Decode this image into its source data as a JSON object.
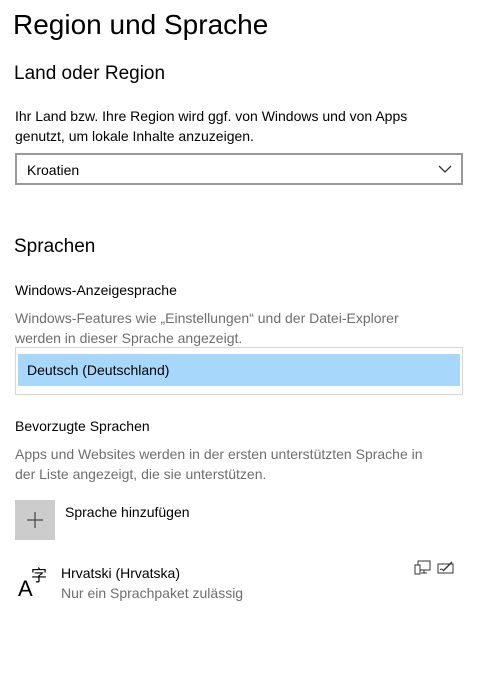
{
  "page": {
    "title": "Region und Sprache"
  },
  "region": {
    "heading": "Land oder Region",
    "description_line1": "Ihr Land bzw. Ihre Region wird ggf. von Windows und von Apps",
    "description_line2": "genutzt, um lokale Inhalte anzuzeigen.",
    "selected": "Kroatien"
  },
  "languages": {
    "heading": "Sprachen",
    "display_language": {
      "heading": "Windows-Anzeigesprache",
      "description_line1": "Windows-Features wie „Einstellungen“ und der Datei-Explorer",
      "description_line2": "werden in dieser Sprache angezeigt.",
      "selected": "Deutsch (Deutschland)"
    },
    "preferred": {
      "heading": "Bevorzugte Sprachen",
      "description_line1": "Apps und Websites werden in der ersten unterstützten Sprache in",
      "description_line2": "der Liste angezeigt, die sie unterstützen.",
      "add_label": "Sprache hinzufügen",
      "items": [
        {
          "name": "Hrvatski (Hrvatska)",
          "status": "Nur ein Sprachpaket zulässig"
        }
      ]
    }
  },
  "icons": {
    "add": "plus-icon",
    "language": "language-icon",
    "display_feature": "display-language-feature-icon",
    "handwriting_feature": "handwriting-feature-icon",
    "chevron": "chevron-down-icon"
  },
  "colors": {
    "selection": "#a7d7fb",
    "add_button": "#cccccc",
    "secondary_text": "#6e6e6e"
  }
}
